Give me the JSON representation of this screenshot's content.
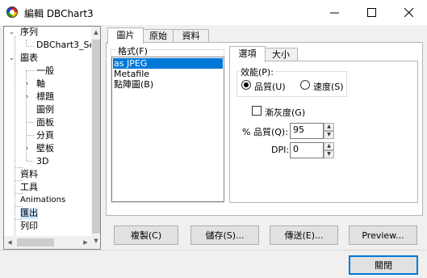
{
  "window": {
    "title": "編輯 DBChart3",
    "buttons": {
      "minimize": "—",
      "maximize": "☐",
      "close": "✕"
    }
  },
  "tree": {
    "items": [
      {
        "label": "序列",
        "expander": "⌄"
      },
      {
        "label": "DBChart3_Se"
      },
      {
        "label": "圖表",
        "expander": "⌄"
      },
      {
        "label": "一般"
      },
      {
        "label": "軸",
        "expander": "›"
      },
      {
        "label": "標題",
        "expander": "›"
      },
      {
        "label": "圖例"
      },
      {
        "label": "面板"
      },
      {
        "label": "分頁"
      },
      {
        "label": "壁板",
        "expander": "›"
      },
      {
        "label": "3D"
      },
      {
        "label": "資料"
      },
      {
        "label": "工具"
      },
      {
        "label": "Animations"
      },
      {
        "label": "匯出"
      },
      {
        "label": "列印"
      }
    ],
    "scroll_arrows": {
      "up": "▲",
      "down": "▼",
      "left": "◀",
      "right": "▶"
    }
  },
  "tabs": [
    "圖片",
    "原始",
    "資料"
  ],
  "format": {
    "label": "格式(F)",
    "items": [
      "as JPEG",
      "Metafile",
      "點陣圖(B)"
    ],
    "selected": "as JPEG"
  },
  "subtabs": [
    "選項",
    "大小"
  ],
  "options": {
    "performance_label": "效能(P):",
    "quality_label": "品質(U)",
    "speed_label": "速度(S)",
    "performance_selected": "quality",
    "grayscale_label": "漸灰度(G)",
    "grayscale_checked": false,
    "quality_field_label": "% 品質(Q):",
    "quality_value": "95",
    "dpi_label": "DPI:",
    "dpi_value": "0",
    "spin_up": "▲",
    "spin_down": "▼"
  },
  "actions": {
    "copy": "複製(C)",
    "save": "儲存(S)...",
    "send": "傳送(E)...",
    "preview": "Preview..."
  },
  "footer": {
    "close": "關閉"
  }
}
